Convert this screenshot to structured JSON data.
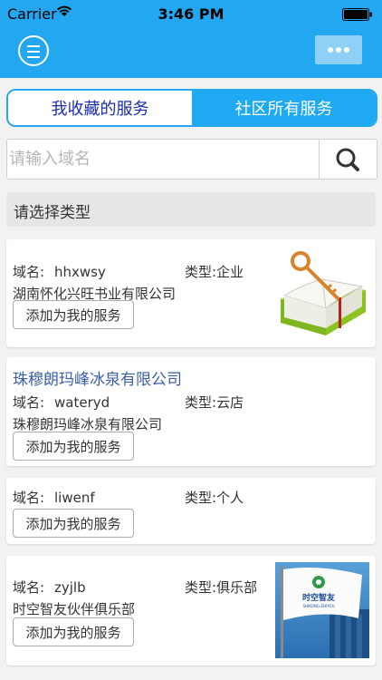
{
  "status_bar": {
    "carrier": "Carrier",
    "time": "3:46 PM"
  },
  "nav": {
    "menu_icon": "menu-icon",
    "more_icon": "more-icon"
  },
  "tabs": [
    {
      "label": "我收藏的服务",
      "selected": true
    },
    {
      "label": "社区所有服务",
      "selected": false
    }
  ],
  "search": {
    "placeholder": "请输入域名",
    "value": ""
  },
  "type_selector": {
    "label": "请选择类型"
  },
  "cards": [
    {
      "title": "",
      "domain_label": "域名:",
      "domain": "hhxwsy",
      "type_label": "类型:",
      "type": "企业",
      "company": "湖南怀化兴旺书业有限公司",
      "button": "添加为我的服务",
      "image": "book-key-image"
    },
    {
      "title": "珠穆朗玛峰冰泉有限公司",
      "domain_label": "域名:",
      "domain": "wateryd",
      "type_label": "类型:",
      "type": "云店",
      "company": "珠穆朗玛峰冰泉有限公司",
      "button": "添加为我的服务",
      "image": ""
    },
    {
      "title": "",
      "domain_label": "域名:",
      "domain": "liwenf",
      "type_label": "类型:",
      "type": "个人",
      "company": "",
      "button": "添加为我的服务",
      "image": ""
    },
    {
      "title": "",
      "domain_label": "域名:",
      "domain": "zyjlb",
      "type_label": "类型:",
      "type": "俱乐部",
      "company": "时空智友伙伴俱乐部",
      "button": "添加为我的服务",
      "image": "flag-logo-image",
      "flag_text": "时空智友",
      "flag_sub": "SHIKONG-ZHIYOU"
    }
  ],
  "colors": {
    "accent": "#23a7f0",
    "title_link": "#3a5fa6",
    "tab_selected_text": "#1a2bb0"
  }
}
